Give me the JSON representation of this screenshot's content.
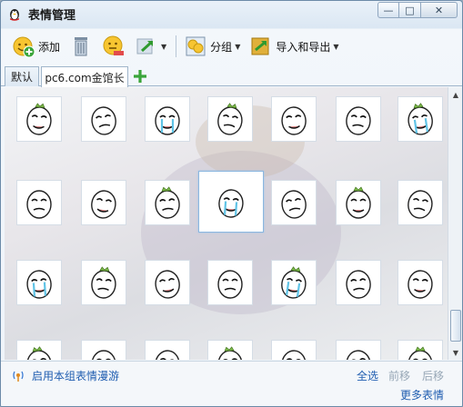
{
  "window": {
    "title": "表情管理",
    "controls": {
      "minimize": "—",
      "maximize": "□",
      "close": "✕"
    }
  },
  "toolbar": {
    "add_label": "添加",
    "group_label": "分组",
    "import_export_label": "导入和导出",
    "icons": [
      "add-emoticon-icon",
      "delete-icon",
      "edit-face-icon",
      "move-icon",
      "group-icon",
      "import-export-icon"
    ]
  },
  "tabs": [
    {
      "label": "默认",
      "active": false
    },
    {
      "label": "pc6.com金馆长",
      "active": true
    }
  ],
  "grid": {
    "rows": 4,
    "cols": 7,
    "selected_row": 1,
    "selected_col": 3
  },
  "footer": {
    "roam_label": "启用本组表情漫游",
    "select_all": "全选",
    "move_forward": "前移",
    "move_back": "后移",
    "more": "更多表情"
  },
  "colors": {
    "link": "#1f5db0",
    "disabled": "#97a7b6",
    "accent_green": "#3aa53a"
  }
}
